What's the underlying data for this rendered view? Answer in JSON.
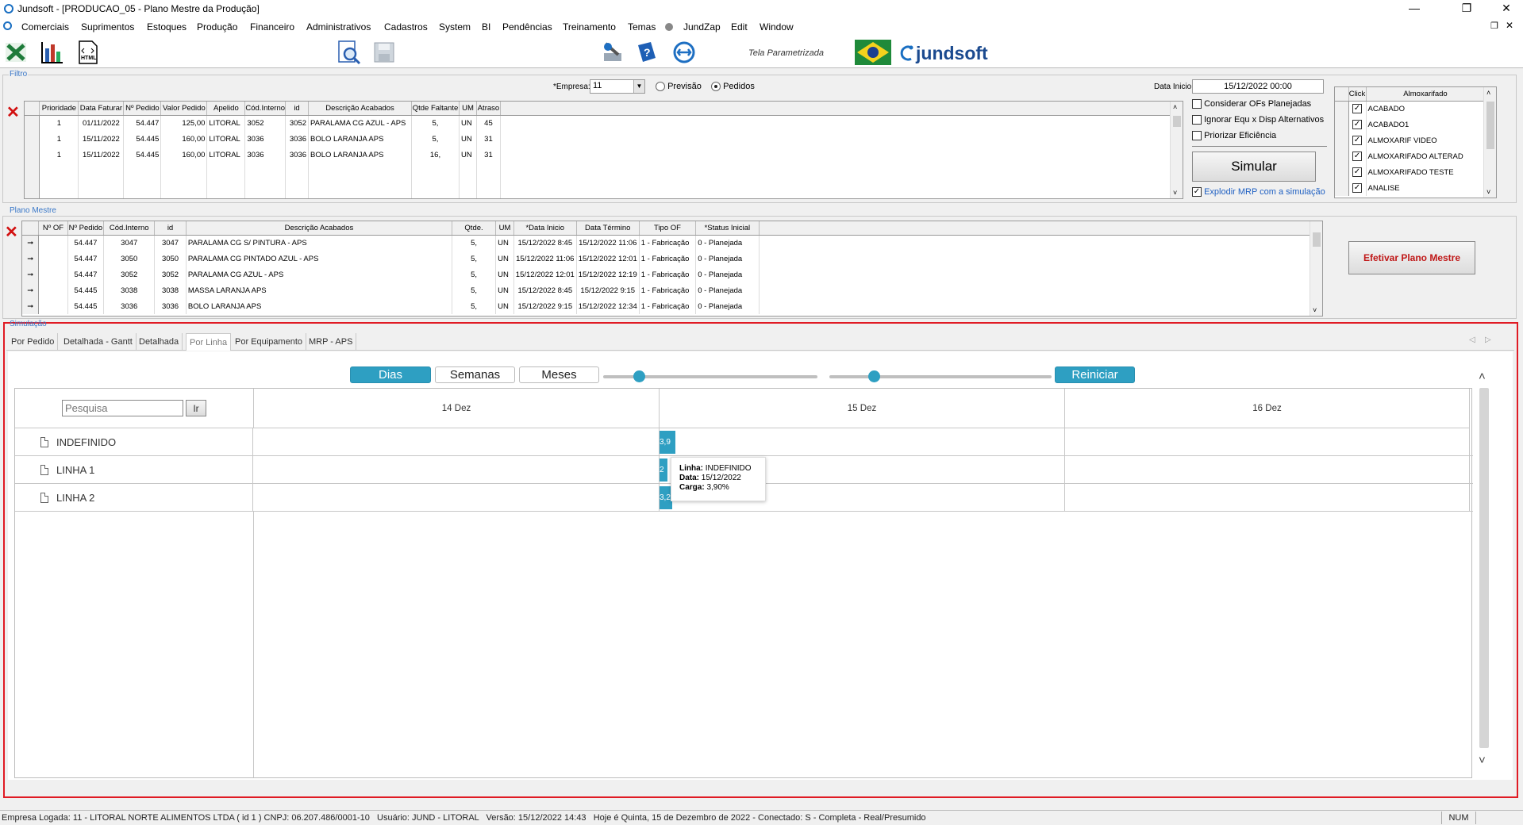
{
  "window": {
    "title": "Jundsoft - [PRODUCAO_05 - Plano Mestre da Produção]",
    "min": "—",
    "max": "❐",
    "close": "✕"
  },
  "menu": [
    "Comerciais",
    "Suprimentos",
    "Estoques",
    "Produção",
    "Financeiro",
    "Administrativos",
    "Cadastros",
    "System",
    "BI",
    "Pendências",
    "Treinamento",
    "Temas",
    "JundZap",
    "Edit",
    "Window"
  ],
  "toolbar": {
    "tela_label": "Tela Parametrizada",
    "brand": "jundsoft"
  },
  "filtro": {
    "label": "Filtro",
    "empresa_label": "*Empresa:",
    "empresa_value": "11",
    "radio_previsao": "Previsão",
    "radio_pedidos": "Pedidos",
    "data_inicio_label": "Data Inicio:",
    "data_inicio_value": "15/12/2022 00:00",
    "columns": [
      "Prioridade",
      "Data Faturar",
      "Nº Pedido",
      "Valor Pedido",
      "Apelido",
      "Cód.Interno",
      "id",
      "Descrição Acabados",
      "Qtde Faltante",
      "UM",
      "Atraso"
    ],
    "rows": [
      [
        "1",
        "01/11/2022",
        "54.447",
        "125,00",
        "LITORAL",
        "3052",
        "3052",
        "PARALAMA CG AZUL - APS",
        "5,",
        "UN",
        "45"
      ],
      [
        "1",
        "15/11/2022",
        "54.445",
        "160,00",
        "LITORAL",
        "3036",
        "3036",
        "BOLO LARANJA APS",
        "5,",
        "UN",
        "31"
      ],
      [
        "1",
        "15/11/2022",
        "54.445",
        "160,00",
        "LITORAL",
        "3036",
        "3036",
        "BOLO LARANJA APS",
        "16,",
        "UN",
        "31"
      ]
    ],
    "chk_considerar": "Considerar OFs Planejadas",
    "chk_ignorar": "Ignorar Equ x Disp Alternativos",
    "chk_priorizar": "Priorizar Eficiência",
    "simular": "Simular",
    "chk_explodir": "Explodir MRP com a simulação",
    "almox_columns": [
      "Click",
      "Almoxarifado"
    ],
    "almox": [
      "ACABADO",
      "ACABADO1",
      "ALMOXARIF VIDEO",
      "ALMOXARIFADO ALTERAD",
      "ALMOXARIFADO TESTE",
      "ANALISE"
    ]
  },
  "plano": {
    "label": "Plano Mestre",
    "columns": [
      "Nº OF",
      "Nº Pedido",
      "Cód.Interno",
      "id",
      "Descrição Acabados",
      "Qtde.",
      "UM",
      "*Data Inicio",
      "Data Término",
      "Tipo OF",
      "*Status Inicial"
    ],
    "rows": [
      [
        "",
        "54.447",
        "3047",
        "3047",
        "PARALAMA CG S/ PINTURA - APS",
        "5,",
        "UN",
        "15/12/2022 8:45",
        "15/12/2022 11:06",
        "1 - Fabricação",
        "0 - Planejada"
      ],
      [
        "",
        "54.447",
        "3050",
        "3050",
        "PARALAMA CG PINTADO AZUL - APS",
        "5,",
        "UN",
        "15/12/2022 11:06",
        "15/12/2022 12:01",
        "1 - Fabricação",
        "0 - Planejada"
      ],
      [
        "",
        "54.447",
        "3052",
        "3052",
        "PARALAMA CG AZUL - APS",
        "5,",
        "UN",
        "15/12/2022 12:01",
        "15/12/2022 12:19",
        "1 - Fabricação",
        "0 - Planejada"
      ],
      [
        "",
        "54.445",
        "3038",
        "3038",
        "MASSA LARANJA APS",
        "5,",
        "UN",
        "15/12/2022 8:45",
        "15/12/2022 9:15",
        "1 - Fabricação",
        "0 - Planejada"
      ],
      [
        "",
        "54.445",
        "3036",
        "3036",
        "BOLO LARANJA APS",
        "5,",
        "UN",
        "15/12/2022 9:15",
        "15/12/2022 12:34",
        "1 - Fabricação",
        "0 - Planejada"
      ]
    ],
    "efetivar": "Efetivar Plano Mestre"
  },
  "simulacao": {
    "label": "Simulação",
    "tabs": [
      "Por Pedido",
      "Detalhada - Gantt",
      "Detalhada",
      "Por Linha",
      "Por Equipamento",
      "MRP - APS"
    ],
    "active_tab": "Por Linha",
    "btn_dias": "Dias",
    "btn_semanas": "Semanas",
    "btn_meses": "Meses",
    "btn_reiniciar": "Reiniciar",
    "search_placeholder": "Pesquisa",
    "search_btn": "Ir",
    "days": [
      "14 Dez",
      "15 Dez",
      "16 Dez"
    ],
    "rows": [
      {
        "name": "INDEFINIDO",
        "bar": "3,9"
      },
      {
        "name": "LINHA 1",
        "bar": "2"
      },
      {
        "name": "LINHA 2",
        "bar": "3,2"
      }
    ],
    "tooltip": {
      "k1": "Linha:",
      "v1": "INDEFINIDO",
      "k2": "Data:",
      "v2": "15/12/2022",
      "k3": "Carga:",
      "v3": "3,90%"
    }
  },
  "status": {
    "text": "Empresa Logada: 11 - LITORAL NORTE ALIMENTOS LTDA ( id 1 ) CNPJ: 06.207.486/0001-10   Usuário: JUND - LITORAL   Versão: 15/12/2022 14:43   Hoje é Quinta, 15 de Dezembro de 2022 - Conectado: S - Completa - Real/Presumido",
    "num": "NUM"
  }
}
